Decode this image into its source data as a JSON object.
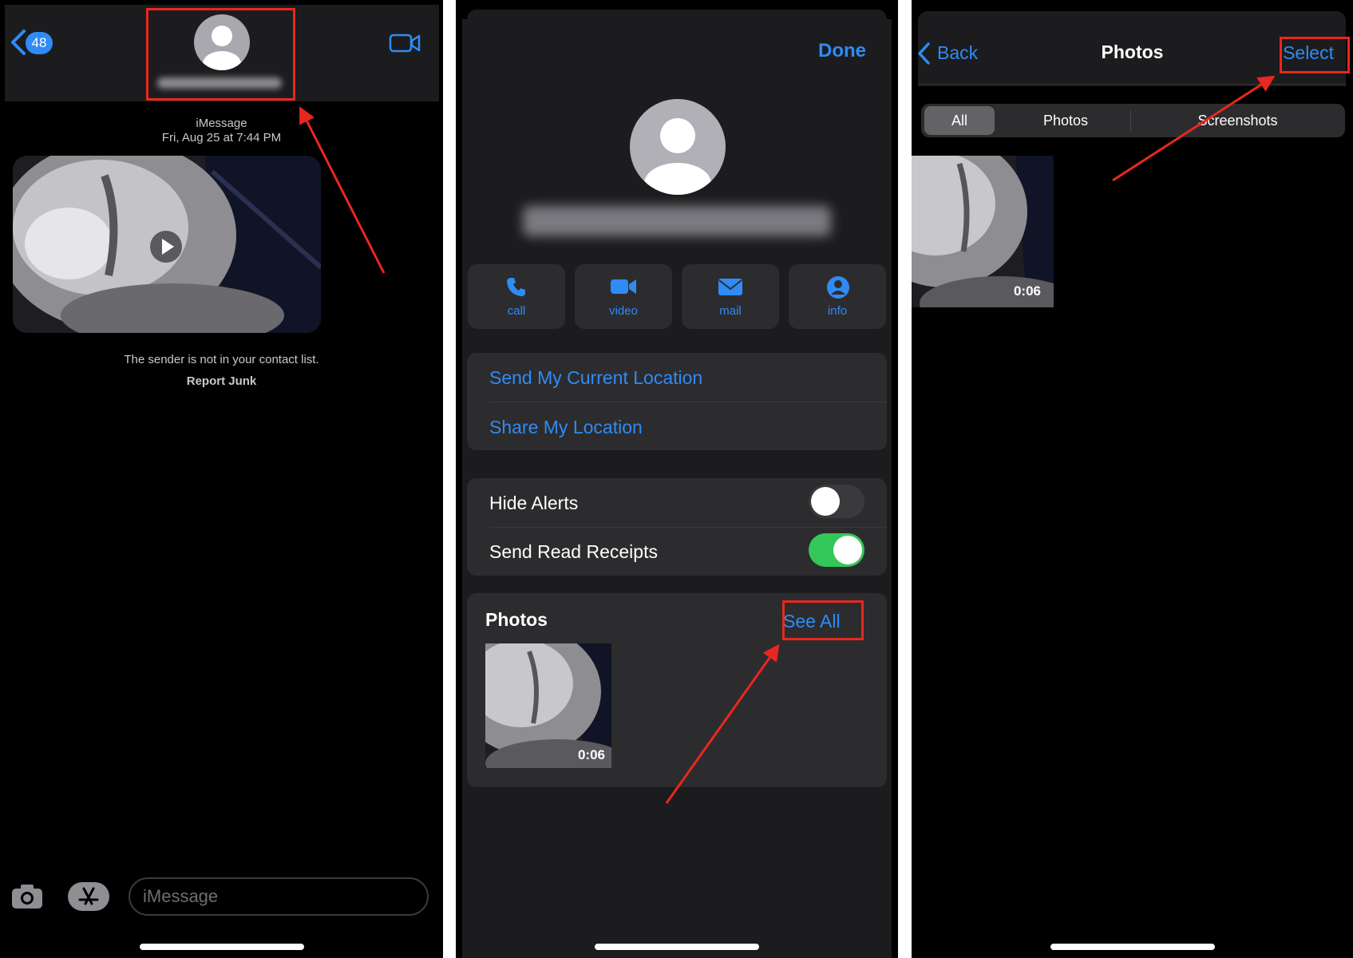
{
  "panel1": {
    "back_badge": "48",
    "service": "iMessage",
    "timestamp": "Fri, Aug 25 at 7:44 PM",
    "sender_notice": "The sender is not in your contact list.",
    "report_junk": "Report Junk",
    "input_placeholder": "iMessage"
  },
  "panel2": {
    "done": "Done",
    "actions": [
      {
        "label": "call",
        "icon": "phone-icon"
      },
      {
        "label": "video",
        "icon": "video-camera-icon"
      },
      {
        "label": "mail",
        "icon": "envelope-icon"
      },
      {
        "label": "info",
        "icon": "person-circle-icon"
      }
    ],
    "location": {
      "send_current": "Send My Current Location",
      "share": "Share My Location"
    },
    "settings": {
      "hide_alerts": {
        "label": "Hide Alerts",
        "on": false
      },
      "read_receipts": {
        "label": "Send Read Receipts",
        "on": true
      }
    },
    "photos": {
      "title": "Photos",
      "see_all": "See All",
      "duration": "0:06"
    }
  },
  "panel3": {
    "back": "Back",
    "title": "Photos",
    "select": "Select",
    "segments": [
      "All",
      "Photos",
      "Screenshots"
    ],
    "selected_segment": "All",
    "duration": "0:06"
  },
  "colors": {
    "accent": "#2f8bf5",
    "annotation": "#e8281e",
    "toggle_on": "#34c759",
    "background": "#000000",
    "card": "#2c2c2e"
  }
}
